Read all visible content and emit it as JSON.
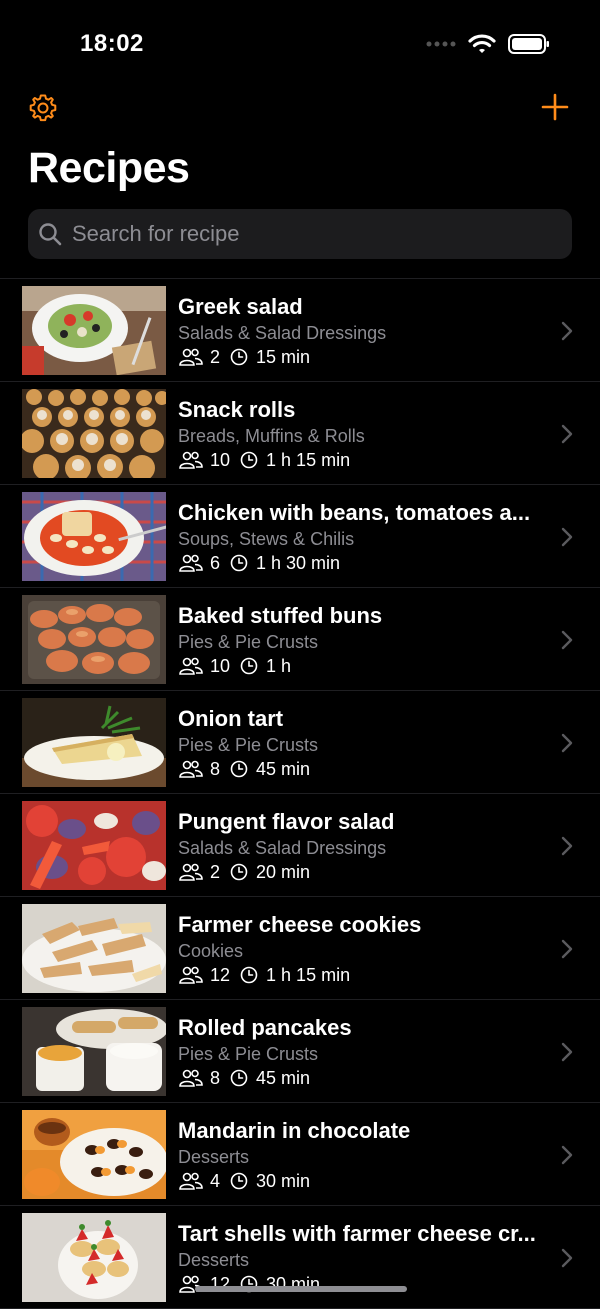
{
  "status": {
    "time": "18:02"
  },
  "nav": {
    "settings_icon": "gear-icon",
    "add_icon": "plus-icon",
    "accent_color": "#ff8c1a"
  },
  "page": {
    "title": "Recipes"
  },
  "search": {
    "placeholder": "Search for recipe"
  },
  "recipes": [
    {
      "title": "Greek salad",
      "category": "Salads & Salad Dressings",
      "servings": "2",
      "time": "15 min"
    },
    {
      "title": "Snack rolls",
      "category": "Breads, Muffins & Rolls",
      "servings": "10",
      "time": "1 h 15 min"
    },
    {
      "title": "Chicken with beans, tomatoes a...",
      "category": "Soups, Stews & Chilis",
      "servings": "6",
      "time": "1 h 30 min"
    },
    {
      "title": "Baked stuffed buns",
      "category": "Pies & Pie Crusts",
      "servings": "10",
      "time": "1 h"
    },
    {
      "title": "Onion tart",
      "category": "Pies & Pie Crusts",
      "servings": "8",
      "time": "45 min"
    },
    {
      "title": "Pungent flavor salad",
      "category": "Salads & Salad Dressings",
      "servings": "2",
      "time": "20 min"
    },
    {
      "title": "Farmer cheese cookies",
      "category": "Cookies",
      "servings": "12",
      "time": "1 h 15 min"
    },
    {
      "title": "Rolled pancakes",
      "category": "Pies & Pie Crusts",
      "servings": "8",
      "time": "45 min"
    },
    {
      "title": "Mandarin in chocolate",
      "category": "Desserts",
      "servings": "4",
      "time": "30 min"
    },
    {
      "title": "Tart shells with farmer cheese cr...",
      "category": "Desserts",
      "servings": "12",
      "time": "30 min"
    }
  ]
}
